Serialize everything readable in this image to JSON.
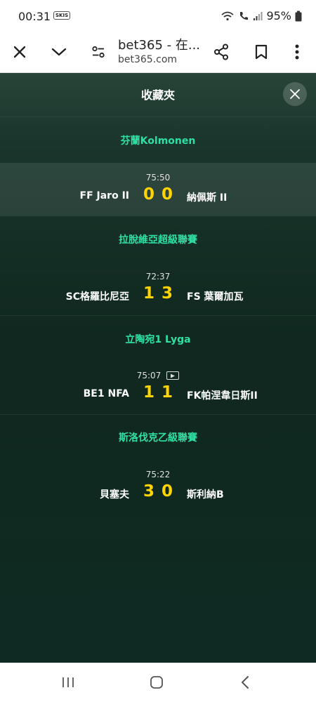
{
  "status": {
    "time": "00:31",
    "skis_label": "SKIS",
    "battery": "95%",
    "icons": [
      "wifi-call-icon",
      "vowifi-icon",
      "signal-icon",
      "battery-icon"
    ]
  },
  "browser": {
    "title": "bet365 - 在...",
    "domain": "bet365.com",
    "icons": [
      "close-icon",
      "chevron-down-icon",
      "tune-icon",
      "share-icon",
      "bookmark-icon",
      "more-vert-icon"
    ]
  },
  "favourites": {
    "title": "收藏夾"
  },
  "leagues": [
    {
      "name": "芬蘭Kolmonen",
      "match": {
        "time": "75:50",
        "home": "FF Jaro II",
        "home_score": "0",
        "away_score": "0",
        "away": "納佩斯 II",
        "video": false,
        "highlighted": true
      }
    },
    {
      "name": "拉脫維亞超級聯賽",
      "match": {
        "time": "72:37",
        "home": "SC格羅比尼亞",
        "home_score": "1",
        "away_score": "3",
        "away": "FS 葉爾加瓦",
        "video": false,
        "highlighted": false
      }
    },
    {
      "name": "立陶宛1 Lyga",
      "match": {
        "time": "75:07",
        "home": "BE1 NFA",
        "home_score": "1",
        "away_score": "1",
        "away": "FK帕涅韋日斯II",
        "video": true,
        "highlighted": false
      }
    },
    {
      "name": "斯洛伐克乙級聯賽",
      "match": {
        "time": "75:22",
        "home": "貝塞夫",
        "home_score": "3",
        "away_score": "0",
        "away": "斯利納B",
        "video": false,
        "highlighted": false
      }
    }
  ],
  "colors": {
    "league": "#2fe0a4",
    "score": "#ffd400",
    "background": "#10281f"
  },
  "nav": {
    "icons": [
      "recent-apps-icon",
      "home-icon",
      "back-icon"
    ]
  }
}
